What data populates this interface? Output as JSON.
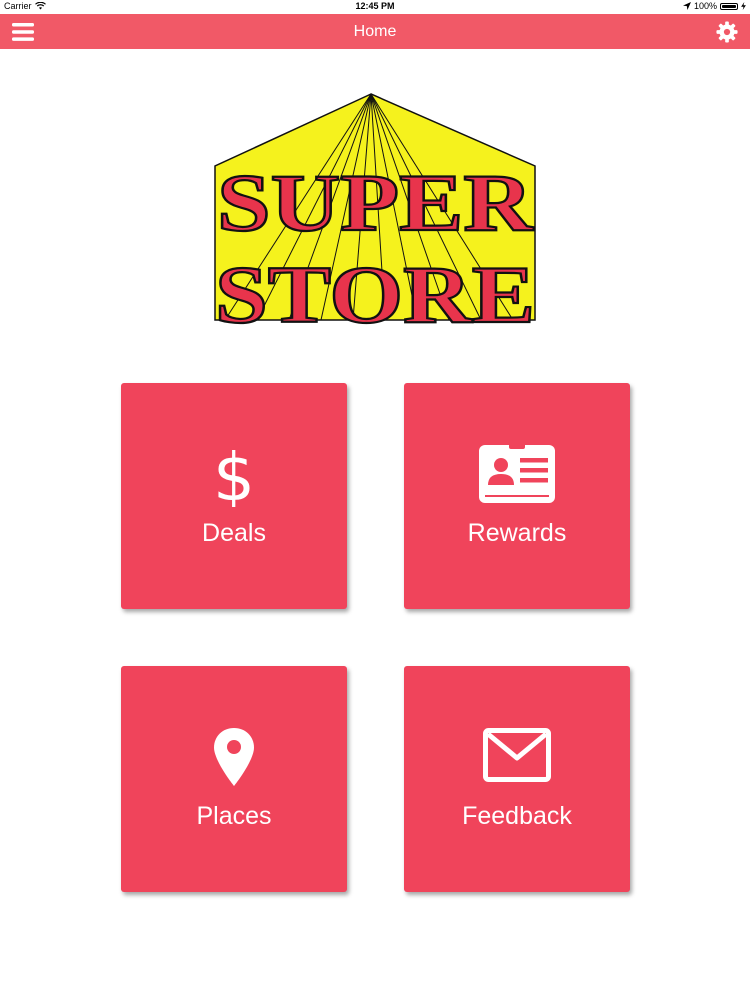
{
  "status_bar": {
    "carrier": "Carrier",
    "time": "12:45 PM",
    "battery_text": "100%",
    "battery_level": 1.0,
    "icons": [
      "wifi-icon",
      "location-arrow-icon",
      "battery-icon",
      "charging-icon"
    ]
  },
  "navbar": {
    "title": "Home",
    "left_icon": "hamburger-menu-icon",
    "right_icon": "gear-icon",
    "background_color": "#f15967"
  },
  "logo": {
    "line1": "SUPER",
    "line2": "STORE",
    "text_color": "#e8344c",
    "ray_color": "#f5f21d"
  },
  "tiles": [
    {
      "label": "Deals",
      "icon": "dollar-sign-icon"
    },
    {
      "label": "Rewards",
      "icon": "id-card-icon"
    },
    {
      "label": "Places",
      "icon": "map-pin-icon"
    },
    {
      "label": "Feedback",
      "icon": "envelope-icon"
    }
  ],
  "colors": {
    "tile_background": "#f0445b",
    "tile_text": "#ffffff",
    "page_background": "#ffffff"
  }
}
